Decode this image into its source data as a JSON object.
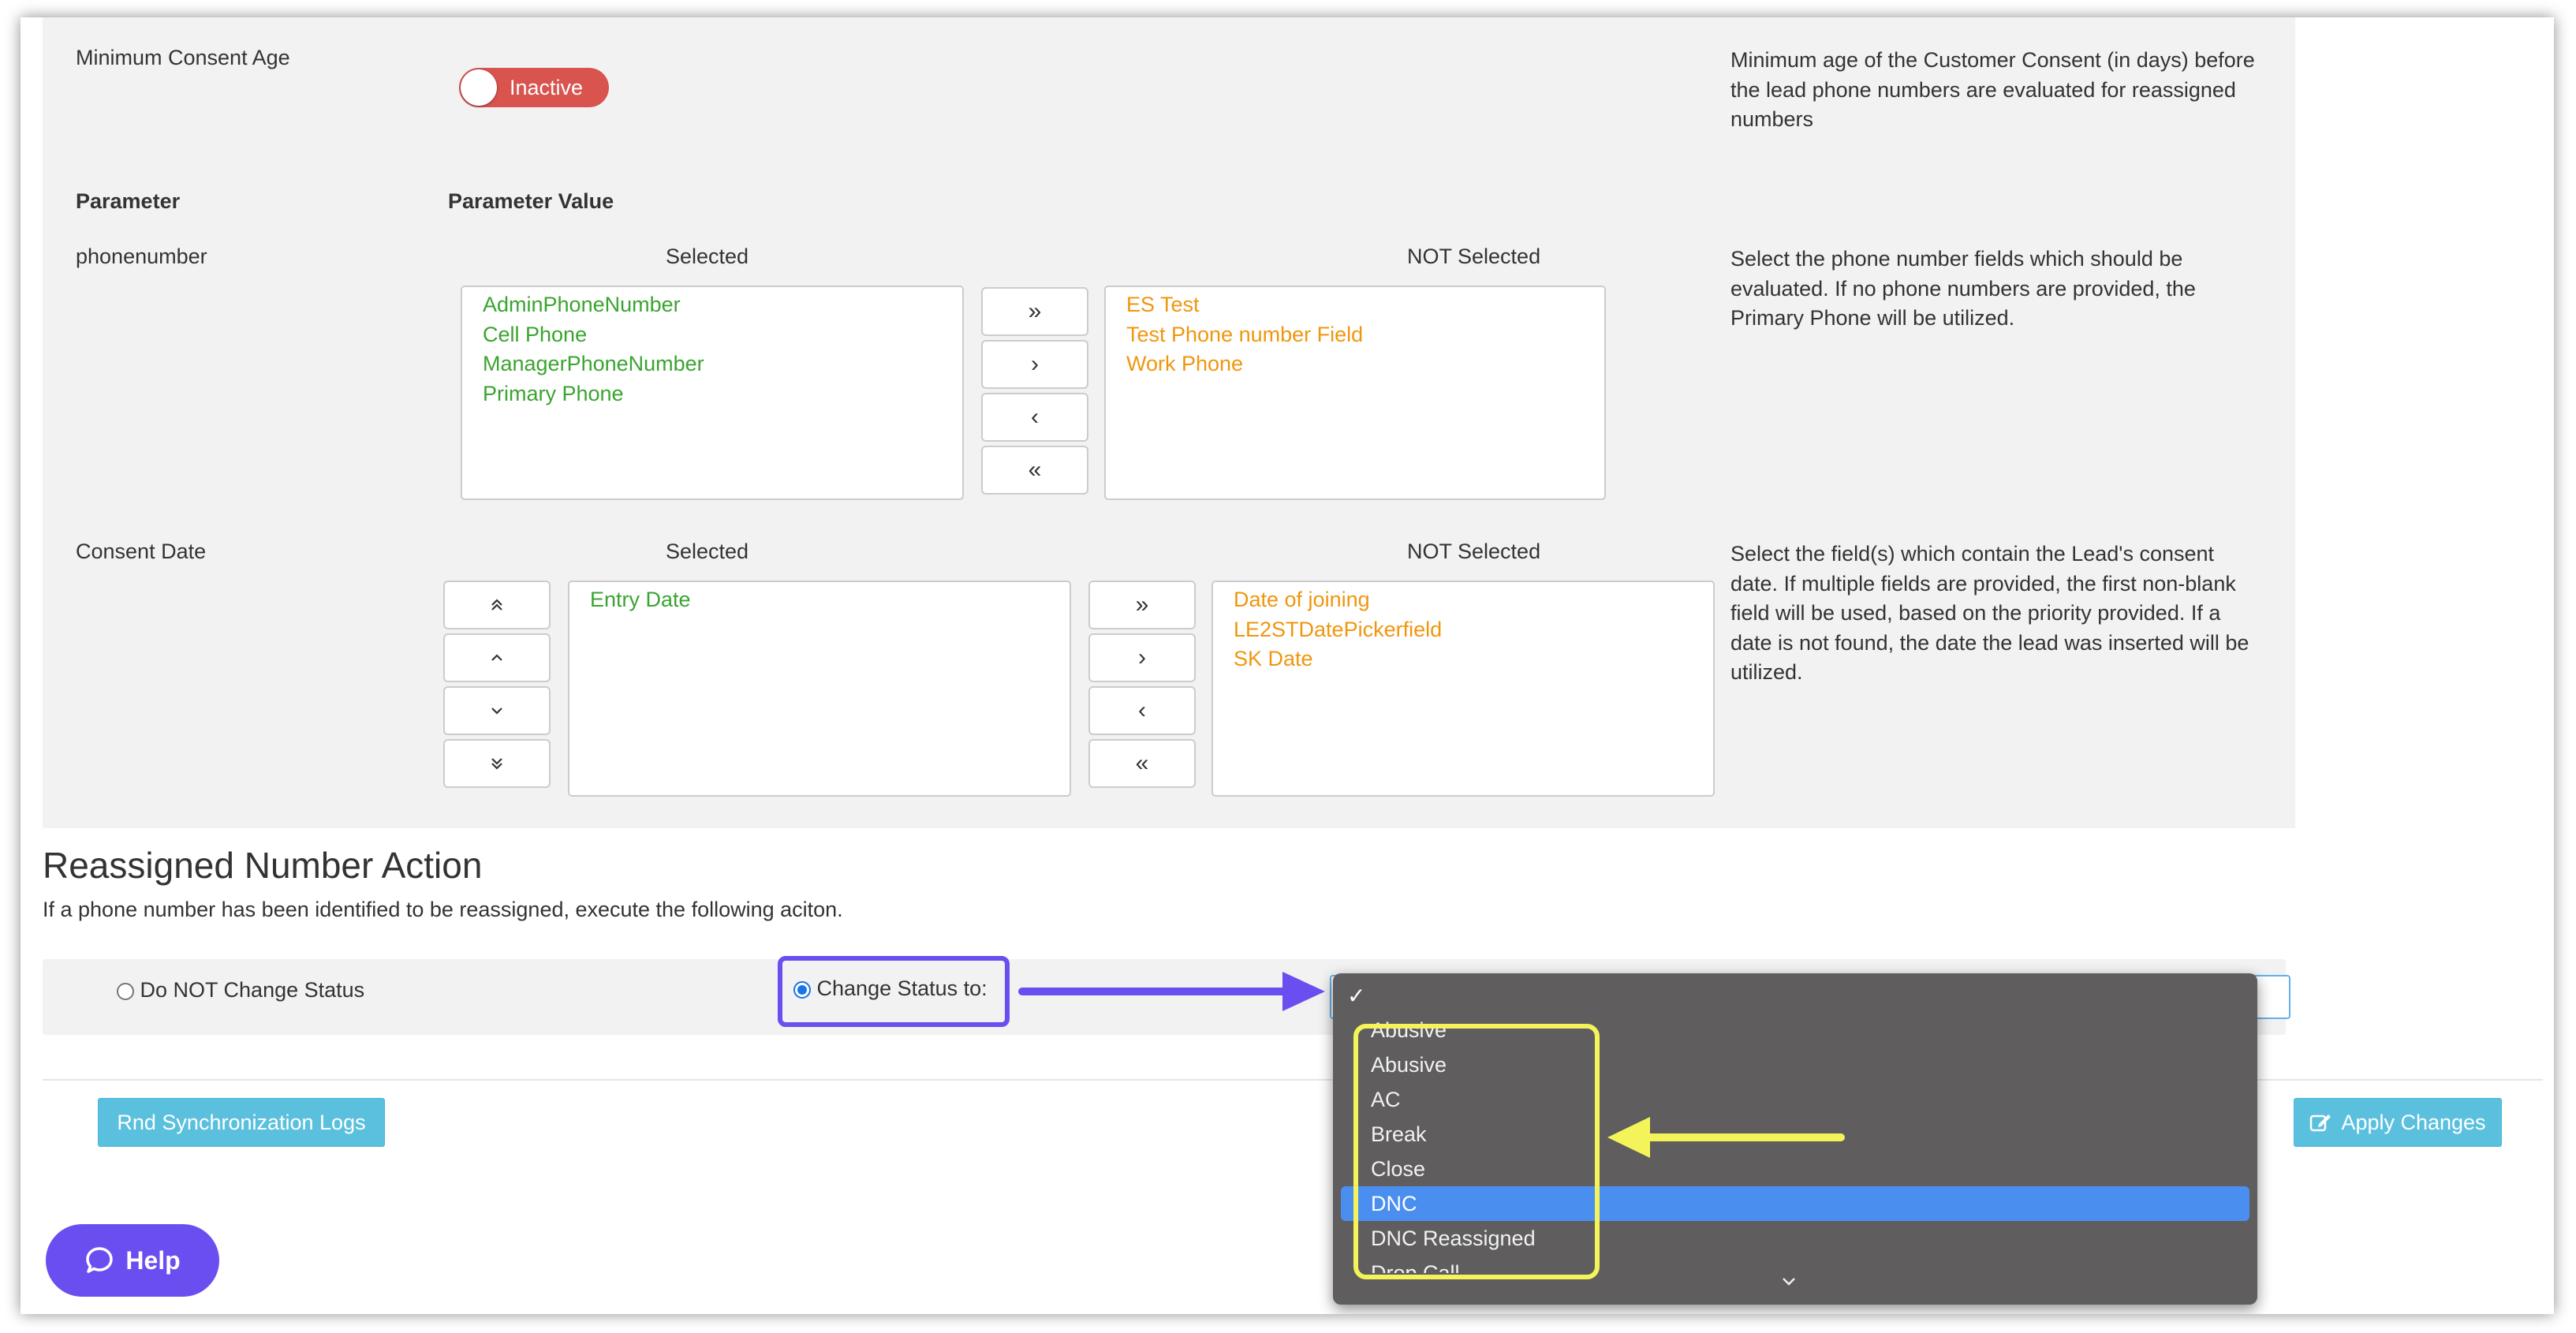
{
  "consent_age": {
    "label": "Minimum Consent Age",
    "toggle_state": "Inactive",
    "description": "Minimum age of the Customer Consent (in days) before the lead phone numbers are evaluated for reassigned numbers"
  },
  "param_table": {
    "col_parameter": "Parameter",
    "col_value": "Parameter Value"
  },
  "phonenumber": {
    "label": "phonenumber",
    "selected_header": "Selected",
    "not_selected_header": "NOT Selected",
    "selected": [
      "AdminPhoneNumber",
      "Cell Phone",
      "ManagerPhoneNumber",
      "Primary Phone"
    ],
    "not_selected": [
      "ES Test",
      "Test Phone number Field",
      "Work Phone"
    ],
    "description": "Select the phone number fields which should be evaluated. If no phone numbers are provided, the Primary Phone will be utilized."
  },
  "consent_date": {
    "label": "Consent Date",
    "selected_header": "Selected",
    "not_selected_header": "NOT Selected",
    "selected": [
      "Entry Date"
    ],
    "not_selected": [
      "Date of joining",
      "LE2STDatePickerfield",
      "SK Date"
    ],
    "description": "Select the field(s) which contain the Lead's consent date. If multiple fields are provided, the first non-blank field will be used, based on the priority provided. If a date is not found, the date the lead was inserted will be utilized."
  },
  "move_buttons": {
    "all_right": "»",
    "right": "›",
    "left": "‹",
    "all_left": "«"
  },
  "reassigned_action": {
    "title": "Reassigned Number Action",
    "subtitle": "If a phone number has been identified to be reassigned, execute the following aciton.",
    "option_no_change": "Do NOT Change Status",
    "option_change": "Change Status to:",
    "selected_option": "change"
  },
  "status_dropdown": {
    "check_mark": "✓",
    "options": [
      "Abusive",
      "Abusive",
      "AC",
      "Break",
      "Close",
      "DNC",
      "DNC Reassigned"
    ],
    "partial_option": "Drop Call",
    "highlighted_option": "DNC"
  },
  "footer": {
    "sync_logs_button": "Rnd Synchronization Logs",
    "apply_button": "Apply Changes",
    "help_button": "Help"
  },
  "colors": {
    "selected_text": "#3aa430",
    "not_selected_text": "#f0960e",
    "toggle_inactive": "#d9534f",
    "annotation_purple": "#6b4ef0",
    "annotation_yellow": "#f4f45a",
    "button_info": "#5bc0de"
  }
}
